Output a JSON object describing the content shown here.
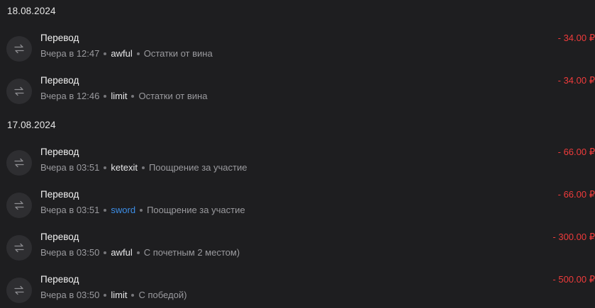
{
  "groups": [
    {
      "date": "18.08.2024",
      "transactions": [
        {
          "title": "Перевод",
          "time": "Вчера в 12:47",
          "user": "awful",
          "comment": "Остатки от вина",
          "amount": "- 34.00 ₽",
          "user_highlight": false
        },
        {
          "title": "Перевод",
          "time": "Вчера в 12:46",
          "user": "limit",
          "comment": "Остатки от вина",
          "amount": "- 34.00 ₽",
          "user_highlight": false
        }
      ]
    },
    {
      "date": "17.08.2024",
      "transactions": [
        {
          "title": "Перевод",
          "time": "Вчера в 03:51",
          "user": "ketexit",
          "comment": "Поощрение за участие",
          "amount": "- 66.00 ₽",
          "user_highlight": false
        },
        {
          "title": "Перевод",
          "time": "Вчера в 03:51",
          "user": "sword",
          "comment": "Поощрение за участие",
          "amount": "- 66.00 ₽",
          "user_highlight": true
        },
        {
          "title": "Перевод",
          "time": "Вчера в 03:50",
          "user": "awful",
          "comment": "С почетным 2 местом)",
          "amount": "- 300.00 ₽",
          "user_highlight": false
        },
        {
          "title": "Перевод",
          "time": "Вчера в 03:50",
          "user": "limit",
          "comment": "С победой)",
          "amount": "- 500.00 ₽",
          "user_highlight": false
        }
      ]
    }
  ],
  "colors": {
    "background": "#1e1e20",
    "amount_negative": "#ef3b3b",
    "user_link": "#3d8fe8"
  },
  "icons": {
    "transaction": "transfer-arrows-icon"
  }
}
